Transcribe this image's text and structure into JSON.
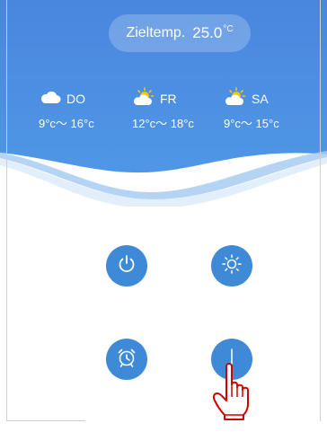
{
  "target": {
    "label": "Zieltemp.",
    "value": "25.0",
    "unit": "°C"
  },
  "forecast": [
    {
      "day": "DO",
      "range": "9°c～ 16°c",
      "icon": "cloud-icon"
    },
    {
      "day": "FR",
      "range": "12°c～ 18°c",
      "icon": "sun-cloud-icon"
    },
    {
      "day": "SA",
      "range": "9°c～ 15°c",
      "icon": "sun-cloud-icon"
    }
  ],
  "buttons": [
    {
      "name": "power-button",
      "icon": "power-icon"
    },
    {
      "name": "brightness-button",
      "icon": "sun-icon"
    },
    {
      "name": "alarm-button",
      "icon": "alarm-clock-icon"
    },
    {
      "name": "down-button",
      "icon": "down-arrow-icon"
    }
  ],
  "colors": {
    "header_blue": "#4c8ee0",
    "button_blue": "#3e8ad6",
    "pointer_red": "#d40000"
  }
}
